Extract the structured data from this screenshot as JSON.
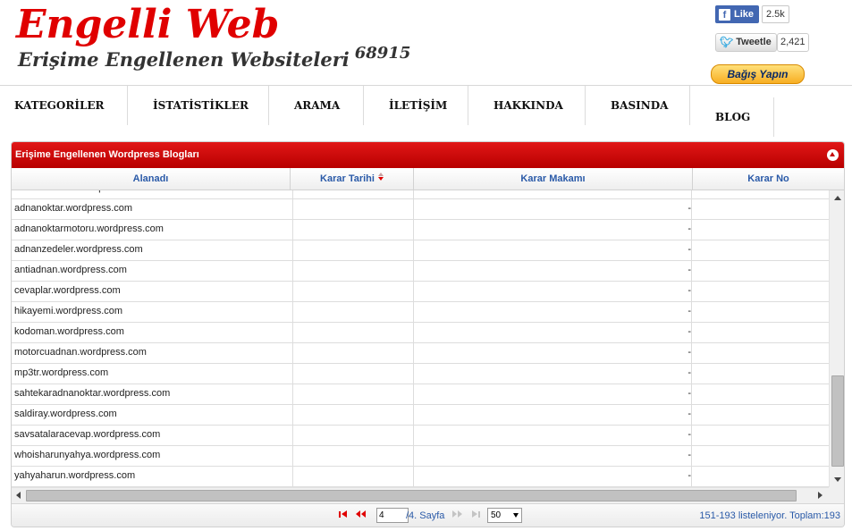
{
  "header": {
    "title": "Engelli Web",
    "subtitle": "Erişime Engellenen Websiteleri",
    "count": "68915",
    "facebook": {
      "label": "Like",
      "count": "2.5k"
    },
    "twitter": {
      "label": "Tweetle",
      "count": "2,421"
    },
    "donate_label": "Bağış Yapın"
  },
  "nav": [
    {
      "label": "KATEGORİLER"
    },
    {
      "label": "İSTATİSTİKLER"
    },
    {
      "label": "ARAMA"
    },
    {
      "label": "İLETİŞİM"
    },
    {
      "label": "HAKKINDA"
    },
    {
      "label": "BASINDA"
    },
    {
      "label": "BLOG"
    }
  ],
  "grid": {
    "caption": "Erişime Engellenen Wordpress Blogları",
    "columns": [
      "Alanadı",
      "Karar Tarihi",
      "Karar Makamı",
      "Karar No"
    ],
    "partial_row": "adnanmartian.wordpress.com",
    "rows": [
      {
        "domain": "adnanoktar.wordpress.com",
        "date": "",
        "authority": "-",
        "no": ""
      },
      {
        "domain": "adnanoktarmotoru.wordpress.com",
        "date": "",
        "authority": "-",
        "no": ""
      },
      {
        "domain": "adnanzedeler.wordpress.com",
        "date": "",
        "authority": "-",
        "no": ""
      },
      {
        "domain": "antiadnan.wordpress.com",
        "date": "",
        "authority": "-",
        "no": ""
      },
      {
        "domain": "cevaplar.wordpress.com",
        "date": "",
        "authority": "-",
        "no": ""
      },
      {
        "domain": "hikayemi.wordpress.com",
        "date": "",
        "authority": "-",
        "no": ""
      },
      {
        "domain": "kodoman.wordpress.com",
        "date": "",
        "authority": "-",
        "no": ""
      },
      {
        "domain": "motorcuadnan.wordpress.com",
        "date": "",
        "authority": "-",
        "no": ""
      },
      {
        "domain": "mp3tr.wordpress.com",
        "date": "",
        "authority": "-",
        "no": ""
      },
      {
        "domain": "sahtekaradnanoktar.wordpress.com",
        "date": "",
        "authority": "-",
        "no": ""
      },
      {
        "domain": "saldiray.wordpress.com",
        "date": "",
        "authority": "-",
        "no": ""
      },
      {
        "domain": "savsatalaracevap.wordpress.com",
        "date": "",
        "authority": "-",
        "no": ""
      },
      {
        "domain": "whoisharunyahya.wordpress.com",
        "date": "",
        "authority": "-",
        "no": ""
      },
      {
        "domain": "yahyaharun.wordpress.com",
        "date": "",
        "authority": "-",
        "no": ""
      }
    ],
    "vertical_scroll_position": 0.95,
    "horizontal_scroll_position": 0.0
  },
  "pager": {
    "page": "4",
    "total_label": "/4. Sayfa",
    "page_size": "50",
    "info": "151-193 listeleniyor. Toplam:193"
  },
  "colors": {
    "title_red": "#e00000",
    "caption_red": "#c40000",
    "header_blue": "#2a5aa8",
    "facebook_blue": "#4267b2"
  }
}
